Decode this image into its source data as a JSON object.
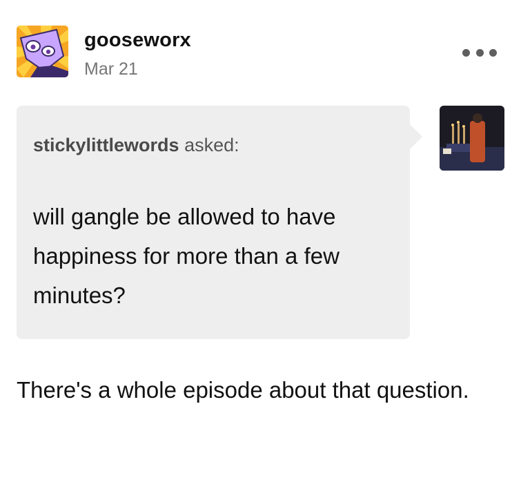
{
  "post": {
    "author": "gooseworx",
    "date": "Mar 21",
    "more_icon": "more-horizontal-icon"
  },
  "ask": {
    "asker": "stickylittlewords",
    "asked_label": " asked:",
    "question": "will gangle be allowed to have happiness for more than a few minutes?"
  },
  "answer": {
    "text": "There's a whole episode about that question."
  },
  "colors": {
    "background": "#ffffff",
    "ask_box": "#eeeeee",
    "date": "#757575",
    "avatar_background": "#f5a623"
  }
}
